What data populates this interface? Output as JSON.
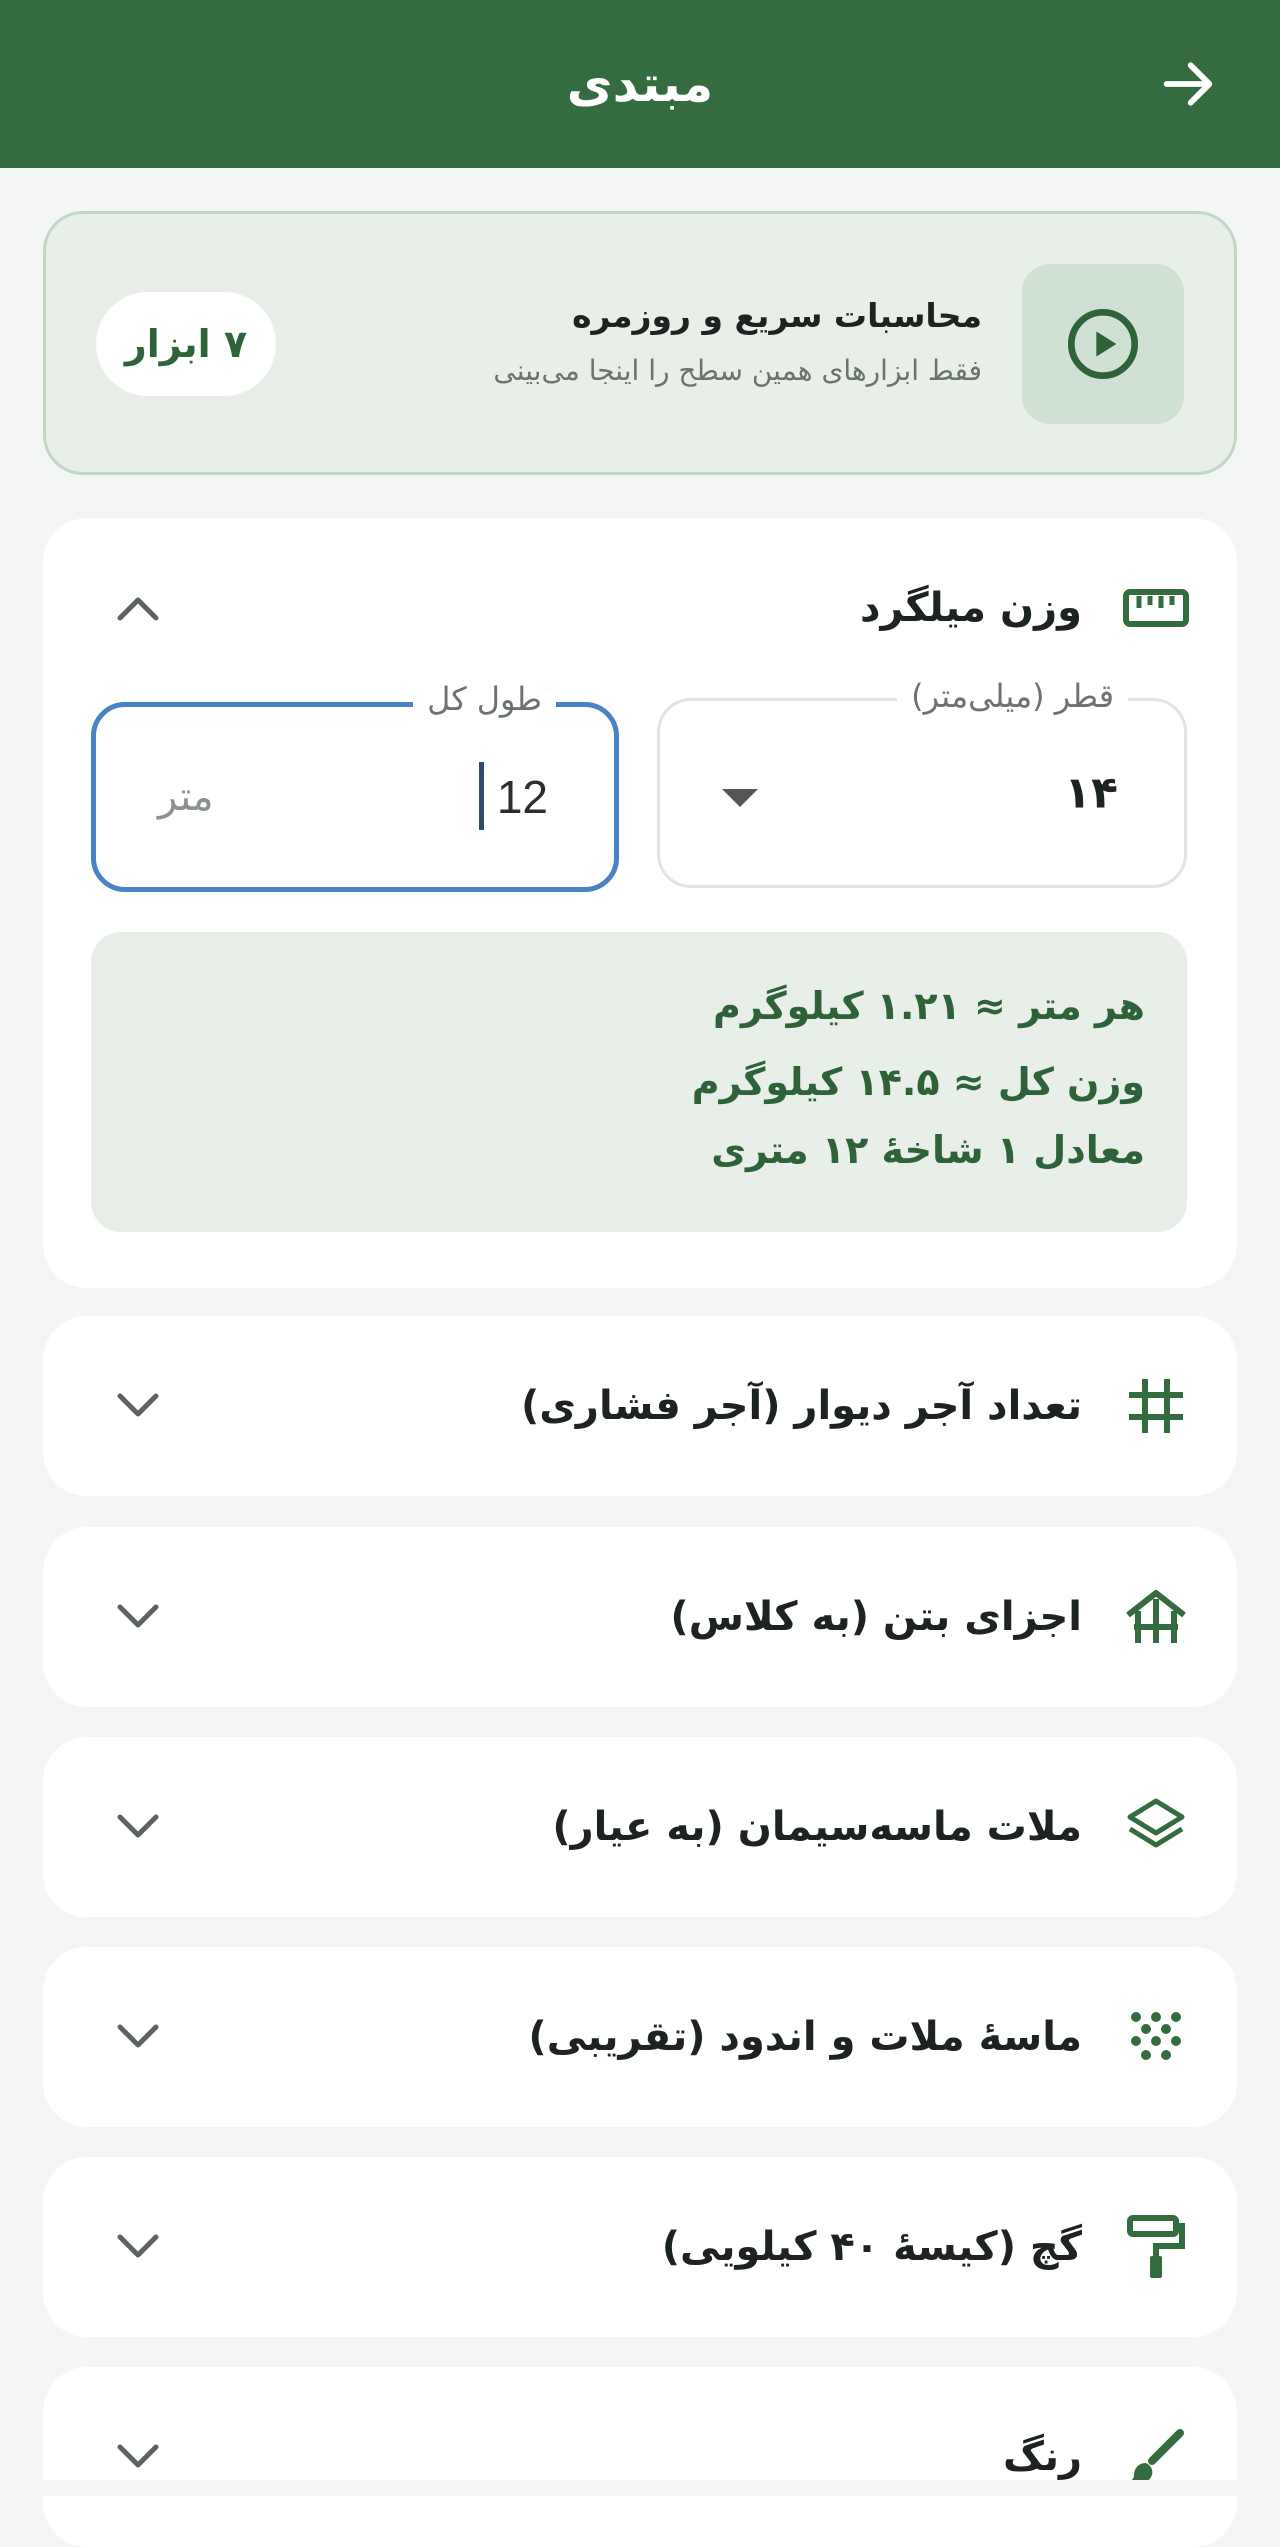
{
  "app_bar": {
    "title": "مبتدی",
    "back_icon": "arrow-right-icon"
  },
  "banner": {
    "heading": "محاسبات سریع و روزمره",
    "subtitle": "فقط ابزارهای همین سطح را اینجا می‌بینی",
    "count": "۷ ابزار",
    "icon": "play-circle-icon"
  },
  "tools": [
    {
      "title": "وزن میلگرد",
      "icon": "ruler-icon",
      "expanded": true,
      "diameter": {
        "label": "قطر (میلی‌متر)",
        "value": "۱۴"
      },
      "length": {
        "label": "طول کل",
        "value": "12",
        "unit": "متر"
      },
      "results": [
        "هر متر ≈ ۱.۲۱ کیلوگرم",
        "وزن کل ≈ ۱۴.۵ کیلوگرم",
        "معادل ۱ شاخهٔ ۱۲ متری"
      ]
    },
    {
      "title": "تعداد آجر دیوار (آجر فشاری)",
      "icon": "grid-icon",
      "expanded": false
    },
    {
      "title": "اجزای بتن (به کلاس)",
      "icon": "foundation-icon",
      "expanded": false
    },
    {
      "title": "ملات ماسه‌سیمان (به عیار)",
      "icon": "layers-icon",
      "expanded": false
    },
    {
      "title": "ماسهٔ ملات و اندود (تقریبی)",
      "icon": "grain-icon",
      "expanded": false
    },
    {
      "title": "گچ (کیسهٔ ۴۰ کیلویی)",
      "icon": "paint-roller-icon",
      "expanded": false
    },
    {
      "title": "رنگ",
      "icon": "brush-icon",
      "expanded": false
    }
  ],
  "colors": {
    "primary": "#356c3f",
    "accent_text": "#2e6238",
    "focus_border": "#4a82c6",
    "background": "#f4f6f5"
  }
}
